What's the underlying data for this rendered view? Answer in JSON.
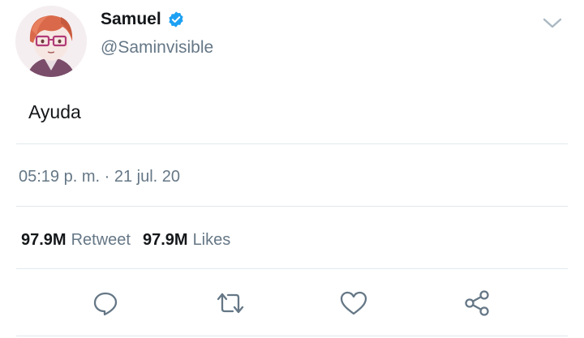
{
  "user": {
    "display_name": "Samuel",
    "handle": "@Saminvisible",
    "verified": true,
    "avatar_icon": "cartoon-avatar-red-hair-glasses"
  },
  "tweet": {
    "text": "Ayuda",
    "timestamp": "05:19 p. m. · 21 jul. 20"
  },
  "stats": {
    "retweets_count": "97.9M",
    "retweets_label": "Retweet",
    "likes_count": "97.9M",
    "likes_label": "Likes"
  },
  "actions": [
    {
      "name": "reply",
      "icon": "speech-bubble-icon"
    },
    {
      "name": "retweet",
      "icon": "retweet-arrows-icon"
    },
    {
      "name": "like",
      "icon": "heart-icon"
    },
    {
      "name": "share",
      "icon": "share-nodes-icon"
    }
  ],
  "colors": {
    "text_primary": "#14171a",
    "text_secondary": "#657786",
    "verified_blue": "#1da1f2",
    "icon_gray": "#657786",
    "divider": "#e1e8ed"
  }
}
